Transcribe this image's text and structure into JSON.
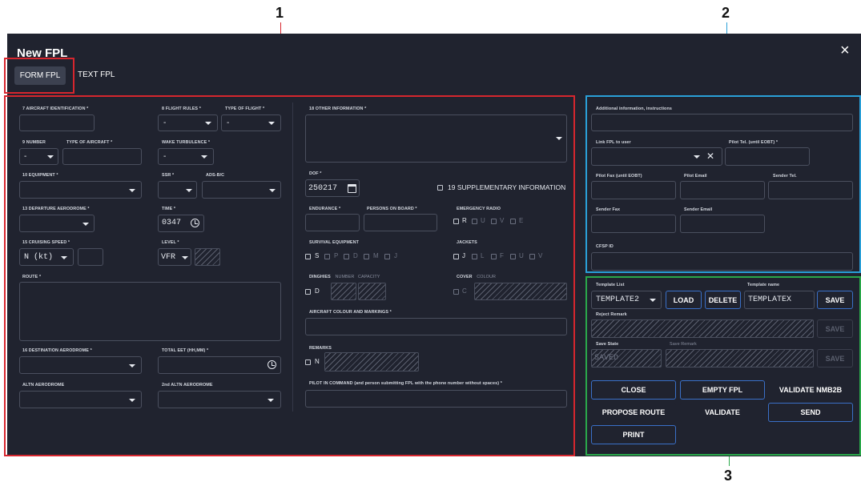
{
  "callouts": [
    "1",
    "2",
    "3"
  ],
  "window": {
    "title": "New FPL",
    "close_icon": "×"
  },
  "tabs": {
    "form": "FORM FPL",
    "text": "TEXT FPL"
  },
  "form": {
    "aircraft_id_label": "7 AIRCRAFT IDENTIFICATION *",
    "flight_rules_label": "8 FLIGHT RULES *",
    "flight_rules_value": "-",
    "type_of_flight_label": "TYPE OF FLIGHT *",
    "type_of_flight_value": "-",
    "number_label": "9 NUMBER",
    "number_value": "-",
    "type_aircraft_label": "TYPE OF AIRCRAFT *",
    "wake_label": "WAKE TURBULENCE *",
    "wake_value": "-",
    "equipment_label": "10 EQUIPMENT *",
    "ssr_label": "SSR *",
    "adsbc_label": "ADS-B/C",
    "departure_label": "13 DEPARTURE AERODROME *",
    "time_label": "TIME *",
    "time_value": "0347",
    "cruising_label": "15 CRUISING SPEED *",
    "cruising_value": "N (kt)",
    "level_label": "LEVEL *",
    "level_value": "VFR",
    "route_label": "ROUTE *",
    "destination_label": "16 DESTINATION AERODROME *",
    "total_eet_label": "TOTAL EET (HH,MM) *",
    "altn_label": "ALTN AERODROME",
    "altn2_label": "2nd ALTN AERODROME",
    "other_info_label": "18 OTHER INFORMATION *",
    "dof_label": "DOF *",
    "dof_value": "250217",
    "supplementary_label": "19 SUPPLEMENTARY INFORMATION",
    "endurance_label": "ENDURANCE *",
    "persons_label": "PERSONS ON BOARD *",
    "emergency_label": "EMERGENCY RADIO",
    "emergency_options": [
      "R",
      "U",
      "V",
      "E"
    ],
    "survival_label": "SURVIVAL EQUIPMENT",
    "survival_options": [
      "S",
      "P",
      "D",
      "M",
      "J"
    ],
    "jackets_label": "JACKETS",
    "jackets_options": [
      "J",
      "L",
      "F",
      "U",
      "V"
    ],
    "dinghies_label": "DINGHIES",
    "dinghies_number": "NUMBER",
    "dinghies_capacity": "CAPACITY",
    "dinghies_option": "D",
    "cover_label": "COVER",
    "cover_colour": "COLOUR",
    "cover_option": "C",
    "aircraft_colour_label": "AIRCRAFT COLOUR AND MARKINGS *",
    "remarks_label": "REMARKS",
    "remarks_option": "N",
    "pilot_label": "PILOT IN COMMAND (and person submitting FPL with the phone number without spaces) *"
  },
  "extra": {
    "additional_label": "Additional information, instructions",
    "link_label": "Link FPL to user",
    "clear_icon": "✕",
    "pilot_tel_label": "Pilot Tel. (until EOBT) *",
    "pilot_fax_label": "Pilot Fax (until EOBT)",
    "pilot_email_label": "Pilot Email",
    "sender_tel_label": "Sender Tel.",
    "sender_fax_label": "Sender Fax",
    "sender_email_label": "Sender Email",
    "cfsp_label": "CFSP ID"
  },
  "template": {
    "list_label": "Template List",
    "list_value": "TEMPLATE2",
    "load": "LOAD",
    "delete": "DELETE",
    "name_label": "Template name",
    "name_value": "TEMPLATEX",
    "save": "SAVE",
    "reject_label": "Reject Remark",
    "save2": "SAVE",
    "save_state_label": "Save State",
    "save_state_value": "SAVED",
    "save_remark_label": "Save Remark",
    "save3": "SAVE"
  },
  "actions": {
    "close": "CLOSE",
    "empty": "EMPTY FPL",
    "validate_nmb2b": "VALIDATE NMB2B",
    "propose": "PROPOSE ROUTE",
    "validate": "VALIDATE",
    "send": "SEND",
    "print": "PRINT"
  },
  "colors": {
    "bg": "#20232f",
    "accent": "#3a70c8",
    "callout_red": "#d6262e",
    "callout_blue": "#2aa0d8",
    "callout_green": "#2aa84a"
  }
}
